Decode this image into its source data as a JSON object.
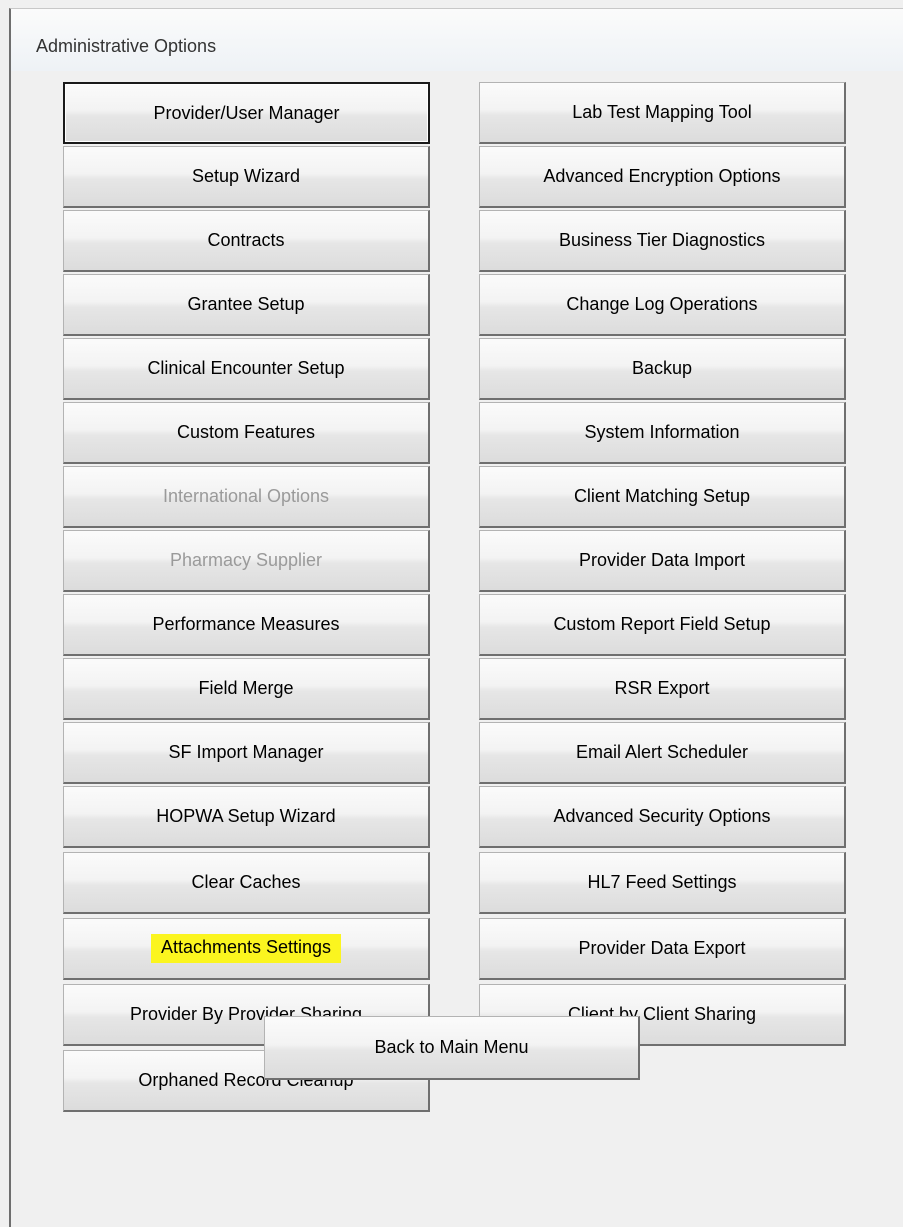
{
  "window": {
    "title": "Administrative Options"
  },
  "left_buttons": [
    {
      "label": "Provider/User Manager",
      "state": "focused"
    },
    {
      "label": "Setup Wizard",
      "state": "normal"
    },
    {
      "label": "Contracts",
      "state": "normal"
    },
    {
      "label": "Grantee Setup",
      "state": "normal"
    },
    {
      "label": "Clinical Encounter Setup",
      "state": "normal"
    },
    {
      "label": "Custom Features",
      "state": "normal"
    },
    {
      "label": "International Options",
      "state": "disabled"
    },
    {
      "label": "Pharmacy Supplier",
      "state": "disabled"
    },
    {
      "label": "Performance Measures",
      "state": "normal"
    },
    {
      "label": "Field Merge",
      "state": "normal"
    },
    {
      "label": "SF Import Manager",
      "state": "normal"
    },
    {
      "label": "HOPWA Setup Wizard",
      "state": "normal"
    },
    {
      "label": "Clear Caches",
      "state": "normal"
    },
    {
      "label": "Attachments Settings",
      "state": "highlighted",
      "highlight_color": "#fbf51f"
    },
    {
      "label": "Provider By Provider Sharing",
      "state": "normal"
    },
    {
      "label": "Orphaned Record Cleanup",
      "state": "normal"
    }
  ],
  "right_buttons": [
    {
      "label": "Lab Test Mapping Tool",
      "state": "normal"
    },
    {
      "label": "Advanced Encryption Options",
      "state": "normal"
    },
    {
      "label": "Business Tier Diagnostics",
      "state": "normal"
    },
    {
      "label": "Change Log Operations",
      "state": "normal"
    },
    {
      "label": "Backup",
      "state": "normal"
    },
    {
      "label": "System Information",
      "state": "normal"
    },
    {
      "label": "Client Matching Setup",
      "state": "normal"
    },
    {
      "label": "Provider Data Import",
      "state": "normal"
    },
    {
      "label": "Custom Report Field Setup",
      "state": "normal"
    },
    {
      "label": "RSR Export",
      "state": "normal"
    },
    {
      "label": "Email Alert Scheduler",
      "state": "normal"
    },
    {
      "label": "Advanced Security Options",
      "state": "normal"
    },
    {
      "label": "HL7 Feed Settings",
      "state": "normal"
    },
    {
      "label": "Provider Data Export",
      "state": "normal"
    },
    {
      "label": "Client by Client Sharing",
      "state": "normal"
    }
  ],
  "back_button": {
    "label": "Back to Main Menu"
  }
}
